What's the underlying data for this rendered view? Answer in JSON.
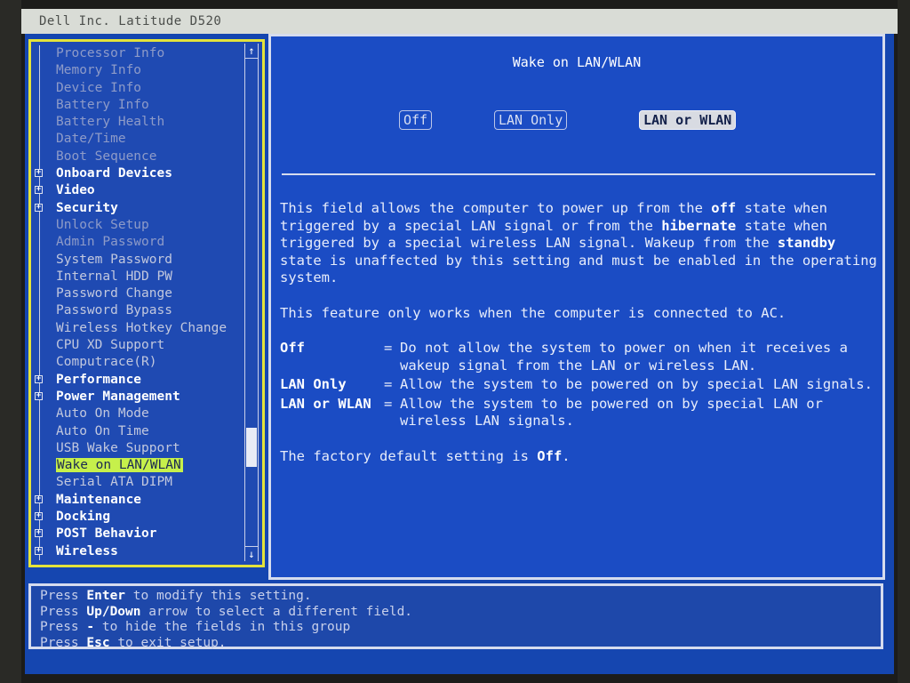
{
  "window": {
    "title": "Dell Inc. Latitude D520"
  },
  "nav": {
    "items": [
      {
        "label": "Processor Info",
        "kind": "child disabled"
      },
      {
        "label": "Memory Info",
        "kind": "child disabled"
      },
      {
        "label": "Device Info",
        "kind": "child disabled"
      },
      {
        "label": "Battery Info",
        "kind": "child disabled"
      },
      {
        "label": "Battery Health",
        "kind": "child disabled"
      },
      {
        "label": "Date/Time",
        "kind": "child disabled"
      },
      {
        "label": "Boot Sequence",
        "kind": "child disabled"
      },
      {
        "label": "Onboard Devices",
        "kind": "group"
      },
      {
        "label": "Video",
        "kind": "group"
      },
      {
        "label": "Security",
        "kind": "group"
      },
      {
        "label": "Unlock Setup",
        "kind": "child disabled"
      },
      {
        "label": "Admin Password",
        "kind": "child disabled"
      },
      {
        "label": "System Password",
        "kind": "child"
      },
      {
        "label": "Internal HDD PW",
        "kind": "child"
      },
      {
        "label": "Password Change",
        "kind": "child"
      },
      {
        "label": "Password Bypass",
        "kind": "child"
      },
      {
        "label": "Wireless Hotkey Change",
        "kind": "child"
      },
      {
        "label": "CPU XD Support",
        "kind": "child"
      },
      {
        "label": "Computrace(R)",
        "kind": "child"
      },
      {
        "label": "Performance",
        "kind": "group"
      },
      {
        "label": "Power Management",
        "kind": "group"
      },
      {
        "label": "Auto On Mode",
        "kind": "child"
      },
      {
        "label": "Auto On Time",
        "kind": "child"
      },
      {
        "label": "USB Wake Support",
        "kind": "child"
      },
      {
        "label": "Wake on LAN/WLAN",
        "kind": "child selected"
      },
      {
        "label": "Serial ATA DIPM",
        "kind": "child"
      },
      {
        "label": "Maintenance",
        "kind": "group"
      },
      {
        "label": "Docking",
        "kind": "group"
      },
      {
        "label": "POST Behavior",
        "kind": "group"
      },
      {
        "label": "Wireless",
        "kind": "group"
      }
    ]
  },
  "detail": {
    "title": "Wake on LAN/WLAN",
    "options": [
      "Off",
      "LAN Only",
      "LAN or WLAN"
    ],
    "selected_option": "LAN or WLAN",
    "help": {
      "p1_a": "This field allows the computer to power up from the ",
      "p1_b": "off",
      "p1_c": " state when triggered by a special LAN signal or from the ",
      "p1_d": "hibernate",
      "p1_e": " state when triggered by a special wireless LAN signal. Wakeup from the ",
      "p1_f": "standby",
      "p1_g": " state is unaffected by this setting and must be enabled in the operating system.",
      "p2": "This feature only works when the computer is connected to AC.",
      "opts": [
        {
          "name": "Off",
          "eq": "=",
          "desc": "Do not allow the system to power on when it receives a wakeup signal from the LAN or wireless LAN."
        },
        {
          "name": "LAN Only",
          "eq": "=",
          "desc": "Allow the system to be powered on by special LAN signals."
        },
        {
          "name": "LAN or WLAN",
          "eq": "=",
          "desc": "Allow the system to be powered on by special LAN or wireless LAN signals."
        }
      ],
      "p3_a": "The factory default setting is ",
      "p3_b": "Off",
      "p3_c": "."
    }
  },
  "hints": {
    "l1_a": "Press ",
    "l1_b": "Enter",
    "l1_c": " to modify this setting.",
    "l2_a": "Press ",
    "l2_b": "Up/Down",
    "l2_c": " arrow to select a different field.",
    "l3_a": "Press ",
    "l3_b": "-",
    "l3_c": " to hide the fields in this group",
    "l4_a": "Press ",
    "l4_b": "Esc",
    "l4_c": " to exit setup."
  },
  "colors": {
    "background": "#1546b0",
    "nav_border": "#e4e33a",
    "selection": "#c6f04b"
  }
}
